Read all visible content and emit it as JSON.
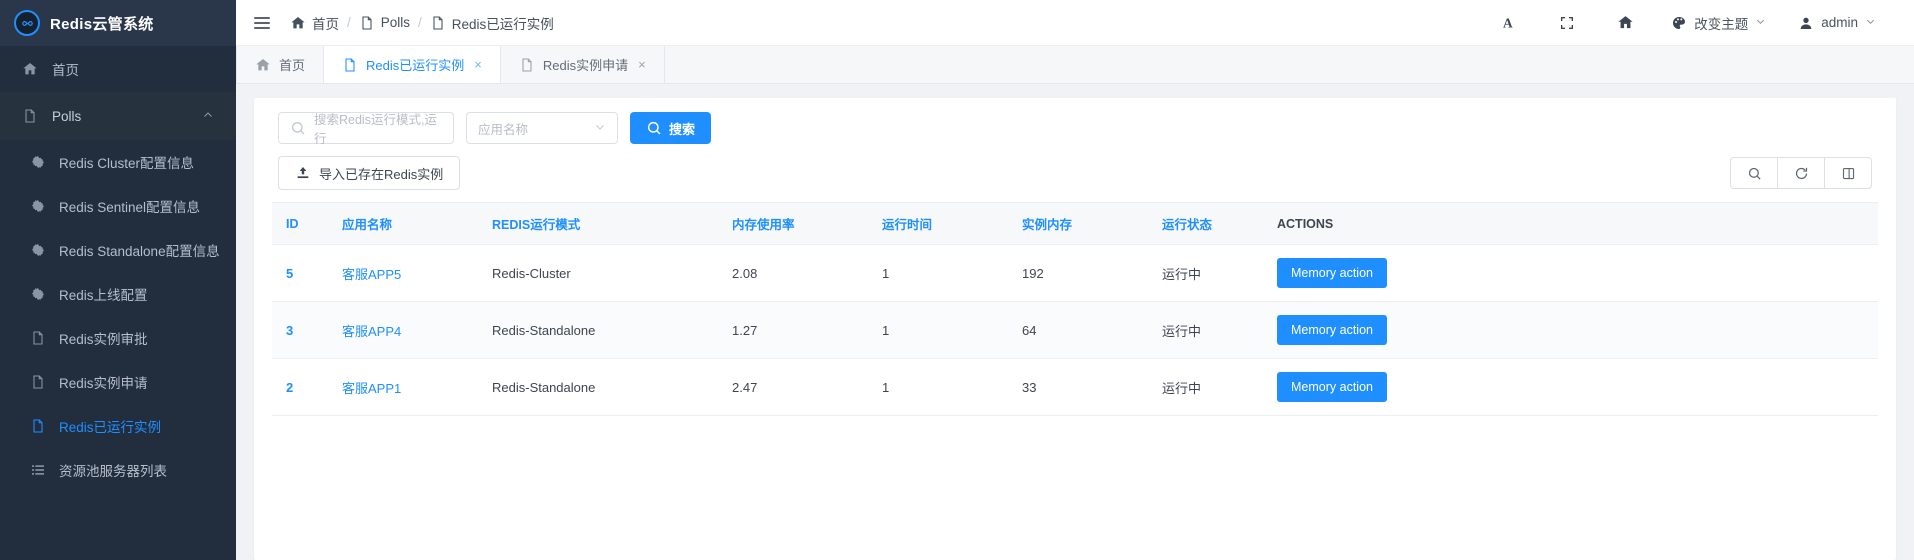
{
  "brand": {
    "title": "Redis云管系统",
    "logo_icon": "infinity-icon"
  },
  "sidebar": {
    "home": {
      "label": "首页",
      "icon": "home-icon"
    },
    "group": {
      "label": "Polls",
      "icon": "file-icon",
      "chevron": "chevron-up-icon"
    },
    "items": [
      {
        "label": "Redis Cluster配置信息",
        "icon": "gear-icon",
        "active": false
      },
      {
        "label": "Redis Sentinel配置信息",
        "icon": "gear-icon",
        "active": false
      },
      {
        "label": "Redis Standalone配置信息",
        "icon": "gear-icon",
        "active": false
      },
      {
        "label": "Redis上线配置",
        "icon": "gear-icon",
        "active": false
      },
      {
        "label": "Redis实例审批",
        "icon": "file-icon",
        "active": false
      },
      {
        "label": "Redis实例申请",
        "icon": "file-icon",
        "active": false
      },
      {
        "label": "Redis已运行实例",
        "icon": "file-icon",
        "active": true
      },
      {
        "label": "资源池服务器列表",
        "icon": "list-icon",
        "active": false
      }
    ]
  },
  "topbar": {
    "menu_icon": "hamburger-icon",
    "breadcrumb": [
      {
        "label": "首页",
        "icon": "home-icon"
      },
      {
        "label": "Polls",
        "icon": "file-icon"
      },
      {
        "label": "Redis已运行实例",
        "icon": "file-icon"
      }
    ],
    "separator": "/",
    "font_size_icon": "font-size-icon",
    "fullscreen_icon": "fullscreen-icon",
    "home_icon": "home-icon",
    "theme": {
      "label": "改变主题",
      "icon": "palette-icon",
      "caret": "chevron-down-icon"
    },
    "user": {
      "label": "admin",
      "icon": "user-icon",
      "caret": "chevron-down-icon"
    }
  },
  "tabs": [
    {
      "label": "首页",
      "icon": "home-icon",
      "active": false,
      "closable": false
    },
    {
      "label": "Redis已运行实例",
      "icon": "file-icon",
      "active": true,
      "closable": true
    },
    {
      "label": "Redis实例申请",
      "icon": "file-icon",
      "active": false,
      "closable": true
    }
  ],
  "tab_close_glyph": "×",
  "filters": {
    "search_placeholder": "搜索Redis运行模式,运行",
    "search_value": "",
    "search_icon": "search-icon",
    "app_select_value": "应用名称",
    "app_select_caret": "chevron-down-icon",
    "search_button": {
      "label": "搜索",
      "icon": "search-icon",
      "color": "#1f8fff"
    }
  },
  "toolbar": {
    "import_button": {
      "label": "导入已存在Redis实例",
      "icon": "upload-icon"
    },
    "icon_buttons": [
      {
        "name": "search-icon"
      },
      {
        "name": "refresh-icon"
      },
      {
        "name": "columns-icon"
      }
    ]
  },
  "table": {
    "columns": [
      "ID",
      "应用名称",
      "REDIS运行模式",
      "内存使用率",
      "运行时间",
      "实例内存",
      "运行状态",
      "ACTIONS"
    ],
    "rows": [
      {
        "id": "5",
        "app": "客服APP5",
        "mode": "Redis-Cluster",
        "usage": "2.08",
        "uptime": "1",
        "memory": "192",
        "status": "运行中",
        "action": "Memory action"
      },
      {
        "id": "3",
        "app": "客服APP4",
        "mode": "Redis-Standalone",
        "usage": "1.27",
        "uptime": "1",
        "memory": "64",
        "status": "运行中",
        "action": "Memory action"
      },
      {
        "id": "2",
        "app": "客服APP1",
        "mode": "Redis-Standalone",
        "usage": "2.47",
        "uptime": "1",
        "memory": "33",
        "status": "运行中",
        "action": "Memory action"
      }
    ]
  },
  "colors": {
    "accent": "#1f8fff",
    "sidebar_bg": "#222d3d",
    "brand_bg": "#2a3649",
    "page_bg": "#f0f2f5"
  }
}
